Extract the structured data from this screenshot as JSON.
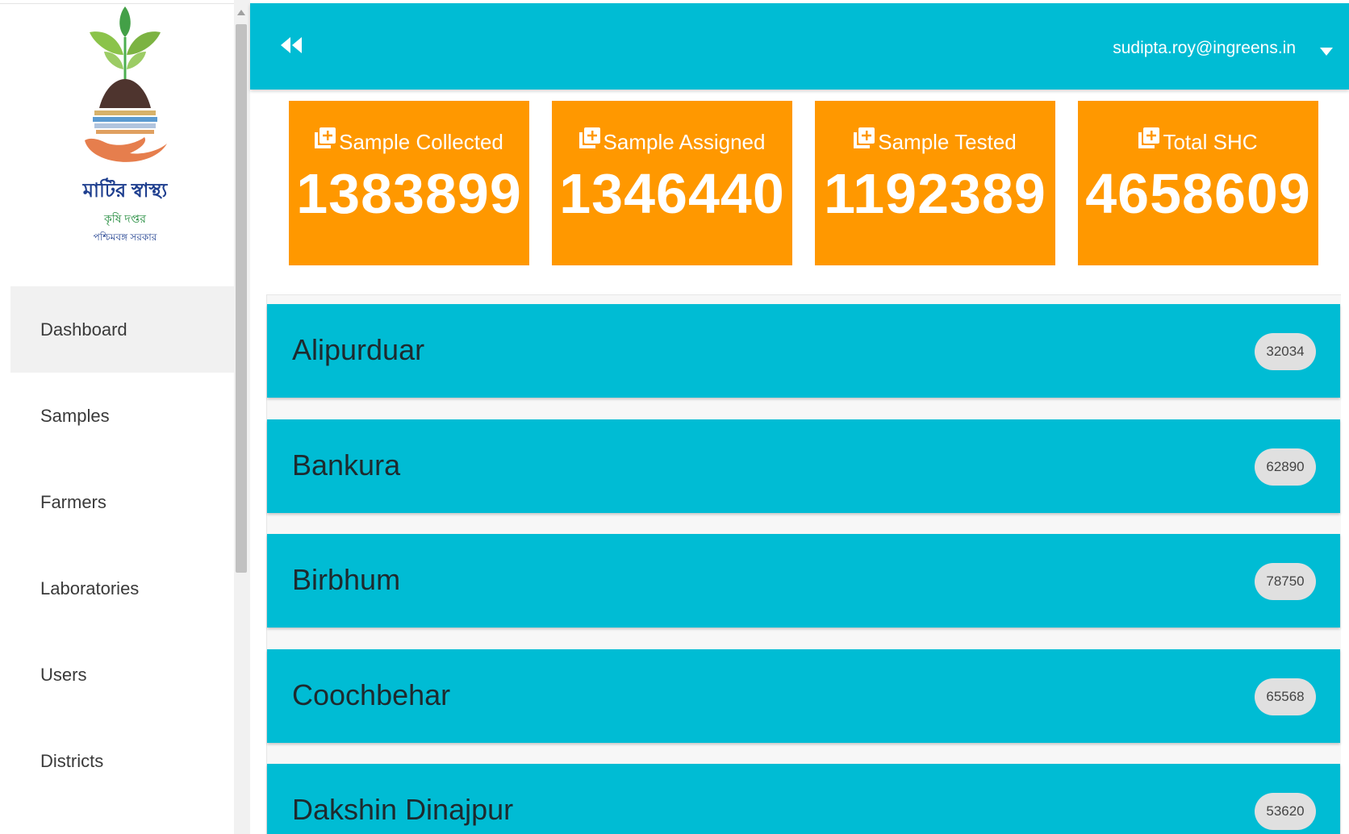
{
  "sidebar": {
    "logo": {
      "line1": "মাটির স্বাস্থ্য",
      "line2": "কৃষি দপ্তর",
      "line3": "পশ্চিমবঙ্গ সরকার"
    },
    "items": [
      {
        "label": "Dashboard",
        "active": true
      },
      {
        "label": "Samples"
      },
      {
        "label": "Farmers"
      },
      {
        "label": "Laboratories"
      },
      {
        "label": "Users"
      },
      {
        "label": "Districts"
      }
    ]
  },
  "header": {
    "collapse_icon": "double-chevron-left-icon",
    "user_email": "sudipta.roy@ingreens.in"
  },
  "stats": [
    {
      "label": "Sample Collected",
      "value": "1383899",
      "icon": "add-box-icon"
    },
    {
      "label": "Sample Assigned",
      "value": "1346440",
      "icon": "add-box-icon"
    },
    {
      "label": "Sample Tested",
      "value": "1192389",
      "icon": "add-box-icon"
    },
    {
      "label": "Total SHC",
      "value": "4658609",
      "icon": "add-box-icon"
    }
  ],
  "districts": [
    {
      "name": "Alipurduar",
      "count": "32034"
    },
    {
      "name": "Bankura",
      "count": "62890"
    },
    {
      "name": "Birbhum",
      "count": "78750"
    },
    {
      "name": "Coochbehar",
      "count": "65568"
    },
    {
      "name": "Dakshin Dinajpur",
      "count": "53620"
    }
  ],
  "colors": {
    "primary": "#00bcd4",
    "card": "#ff9800",
    "nav_active_bg": "#f1f1f1",
    "badge_bg": "#e0e0e0"
  }
}
